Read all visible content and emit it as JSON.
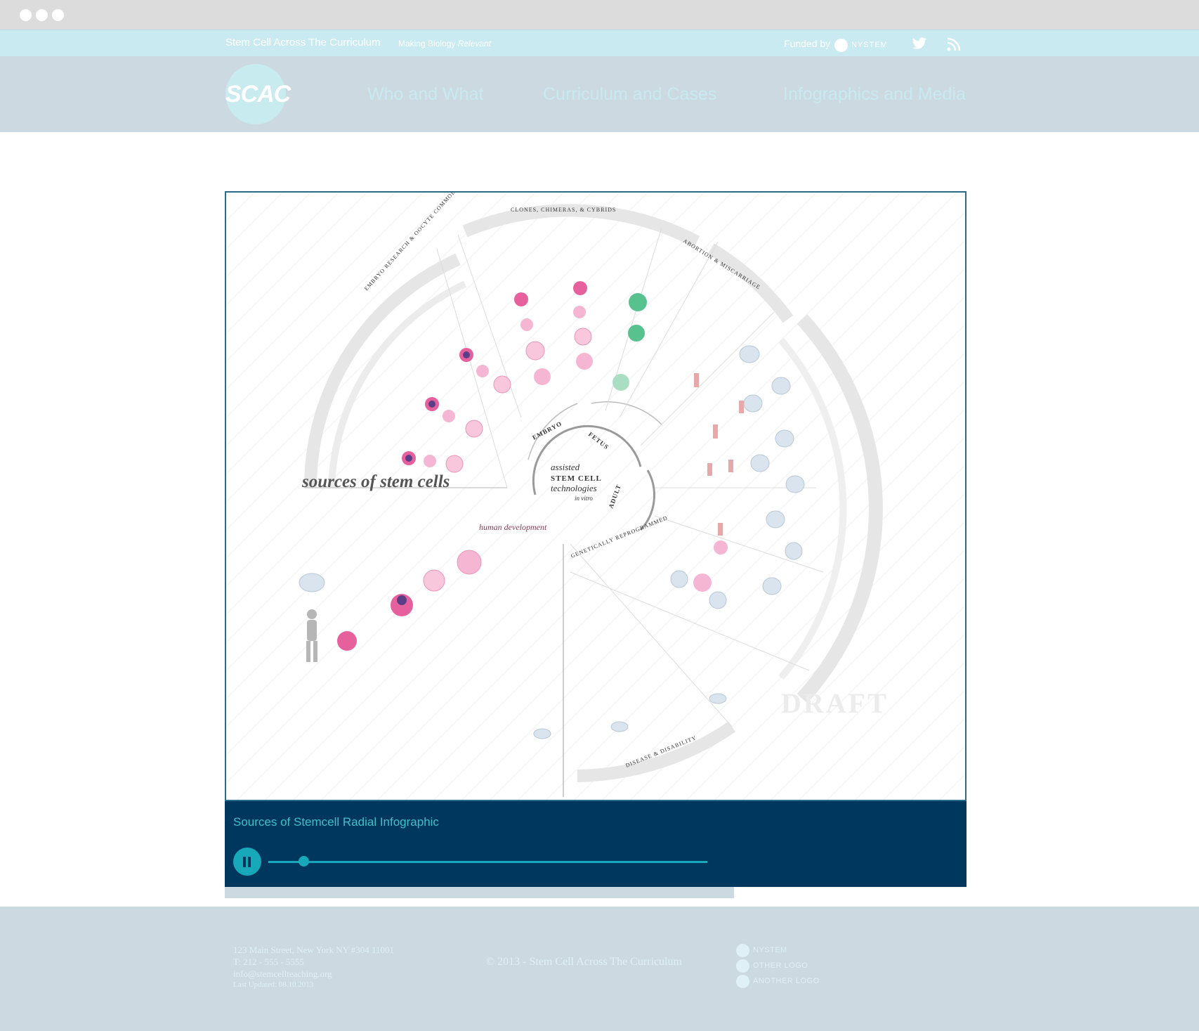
{
  "header": {
    "site_title": "Stem Cell Across The Curriculum",
    "tagline_prefix": "Making Biology",
    "tagline_emph": "Relevant",
    "funded_by": "Funded by",
    "funder": "NYSTEM"
  },
  "nav": {
    "logo": "SCAC",
    "items": [
      "Who and What",
      "Curriculum and Cases",
      "Infographics and Media"
    ]
  },
  "media": {
    "caption": "Sources of Stemcell Radial Infographic",
    "progress": 0.08,
    "infographic": {
      "main_title": "sources of stem cells",
      "center_line1": "assisted",
      "center_line2": "STEM CELL",
      "center_line3": "technologies",
      "center_line4": "in vitro",
      "ring_labels": [
        "EMBRYO",
        "FETUS",
        "ADULT"
      ],
      "section_labels": [
        "CLONES, CHIMERAS, & CYBRIDS",
        "ABORTION & MISCARRIAGE",
        "EMBRYO RESEARCH & OOCYTE COMMODITIES",
        "GENETICALLY REPROGRAMMED",
        "DISEASE & DISABILITY"
      ],
      "human_dev": "human development",
      "draft": "DRAFT"
    }
  },
  "footer": {
    "address": "123 Main Street, New York NY #304 11001",
    "phone": "T: 212 - 555 - 5555",
    "email": "info@stemcellteaching.org",
    "updated": "Last Updated: 08.10.2013",
    "copyright": "© 2013 - Stem Cell Across The Curriculum",
    "logos": [
      "NYSTEM",
      "OTHER LOGO",
      "ANOTHER LOGO"
    ]
  }
}
